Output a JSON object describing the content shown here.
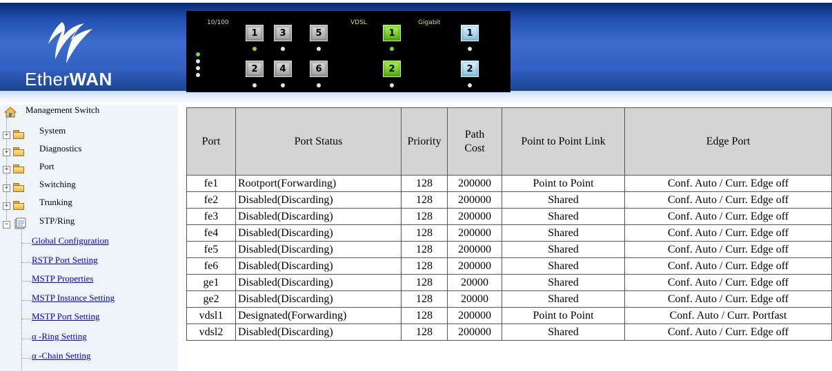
{
  "header": {
    "brand": {
      "prefix": "Ether",
      "suffix": "WAN"
    },
    "panel": {
      "label_10_100": "10/100",
      "label_vdsl": "VDSL",
      "label_gigabit": "Gigabit",
      "fe_ports": [
        "1",
        "3",
        "5",
        "2",
        "4",
        "6"
      ],
      "vdsl_ports": [
        "1",
        "2"
      ],
      "gig_ports": [
        "1",
        "2"
      ]
    },
    "colors": {
      "banner_blue": "#3c6ccd",
      "vdsl_green": "#6fc21e",
      "gigabit_blue": "#9fd0e8"
    }
  },
  "sidebar": {
    "root": "Management Switch",
    "folders": [
      "System",
      "Diagnostics",
      "Port",
      "Switching",
      "Trunking",
      "STP/Ring"
    ],
    "links": [
      "Global Configuration",
      "RSTP Port Setting",
      "MSTP Properties",
      "MSTP Instance Setting",
      "MSTP Port Setting",
      "α -Ring Setting",
      "α -Chain Setting"
    ]
  },
  "table": {
    "headers": [
      "Port",
      "Port Status",
      "Priority",
      "Path Cost",
      "Point to Point Link",
      "Edge Port"
    ],
    "rows": [
      [
        "fe1",
        "Rootport(Forwarding)",
        "128",
        "200000",
        "Point to Point",
        "Conf. Auto / Curr. Edge off"
      ],
      [
        "fe2",
        "Disabled(Discarding)",
        "128",
        "200000",
        "Shared",
        "Conf. Auto / Curr. Edge off"
      ],
      [
        "fe3",
        "Disabled(Discarding)",
        "128",
        "200000",
        "Shared",
        "Conf. Auto / Curr. Edge off"
      ],
      [
        "fe4",
        "Disabled(Discarding)",
        "128",
        "200000",
        "Shared",
        "Conf. Auto / Curr. Edge off"
      ],
      [
        "fe5",
        "Disabled(Discarding)",
        "128",
        "200000",
        "Shared",
        "Conf. Auto / Curr. Edge off"
      ],
      [
        "fe6",
        "Disabled(Discarding)",
        "128",
        "200000",
        "Shared",
        "Conf. Auto / Curr. Edge off"
      ],
      [
        "ge1",
        "Disabled(Discarding)",
        "128",
        "20000",
        "Shared",
        "Conf. Auto / Curr. Edge off"
      ],
      [
        "ge2",
        "Disabled(Discarding)",
        "128",
        "20000",
        "Shared",
        "Conf. Auto / Curr. Edge off"
      ],
      [
        "vdsl1",
        "Designated(Forwarding)",
        "128",
        "200000",
        "Point to Point",
        "Conf. Auto / Curr. Portfast"
      ],
      [
        "vdsl2",
        "Disabled(Discarding)",
        "128",
        "200000",
        "Shared",
        "Conf. Auto / Curr. Edge off"
      ]
    ]
  }
}
